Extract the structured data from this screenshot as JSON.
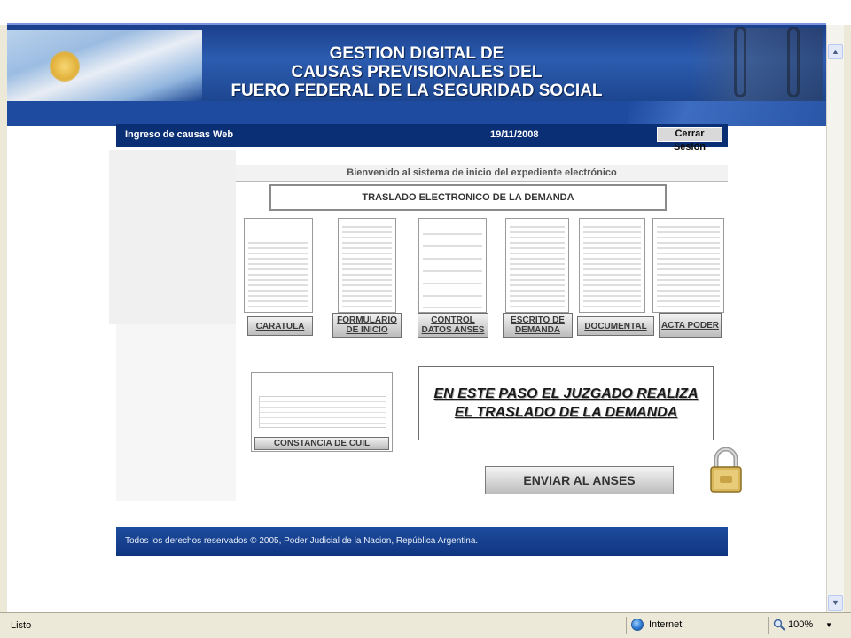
{
  "banner": {
    "title_lines": [
      "GESTION DIGITAL DE",
      "CAUSAS PREVISIONALES DEL",
      "FUERO FEDERAL DE LA SEGURIDAD SOCIAL"
    ]
  },
  "app_bar": {
    "title": "Ingreso de causas Web",
    "date": "19/11/2008",
    "logout_label": "Cerrar Sesión"
  },
  "welcome": "Bienvenido al sistema de inicio del expediente electrónico",
  "step_title": "TRASLADO ELECTRONICO DE LA DEMANDA",
  "documents": [
    {
      "label": "CARATULA"
    },
    {
      "label": "FORMULARIO DE INICIO"
    },
    {
      "label": "CONTROL DATOS ANSES"
    },
    {
      "label": "ESCRITO DE DEMANDA"
    },
    {
      "label": "DOCUMENTAL"
    },
    {
      "label": "ACTA PODER"
    }
  ],
  "cuil": {
    "label": "CONSTANCIA DE CUIL"
  },
  "note": "EN ESTE PASO EL JUZGADO REALIZA EL TRASLADO DE LA DEMANDA",
  "send_label": "ENVIAR AL ANSES",
  "footer": "Todos los derechos reservados © 2005, Poder Judicial de la Nacion, República Argentina.",
  "status_bar": {
    "status": "Listo",
    "zone": "Internet",
    "zoom": "100%"
  },
  "icons": {
    "lock": "padlock-icon",
    "zone": "globe-icon",
    "zoom": "magnifier-icon"
  },
  "colors": {
    "banner": "#1b3f8c",
    "app_bar": "#0b2f75",
    "footer": "#1e4c9e"
  }
}
